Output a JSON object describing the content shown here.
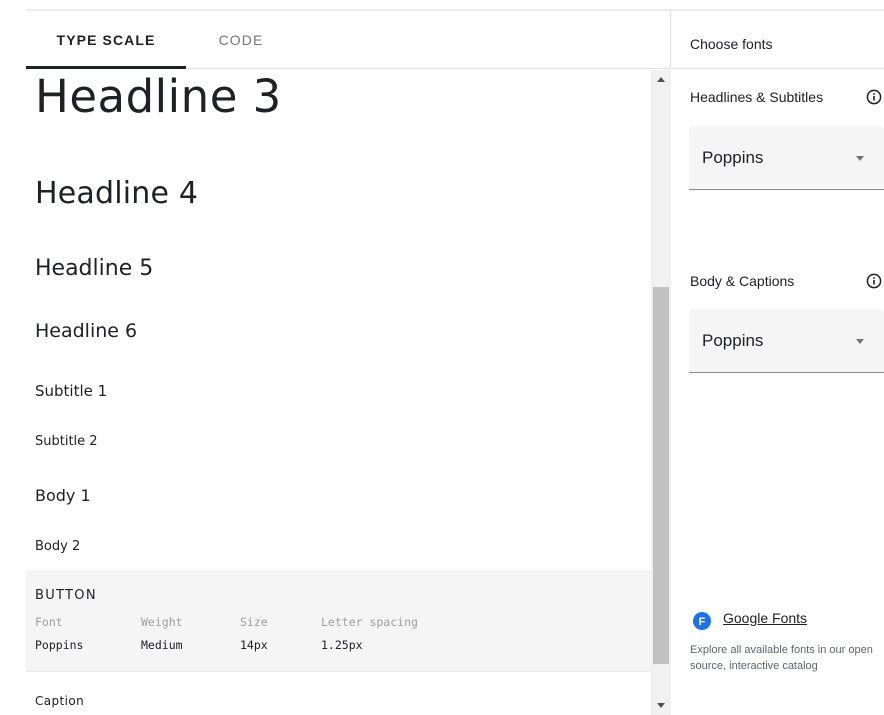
{
  "tabs": {
    "type_scale": "TYPE SCALE",
    "code": "CODE"
  },
  "type_scale": {
    "headline3": "Headline 3",
    "headline4": "Headline 4",
    "headline5": "Headline 5",
    "headline6": "Headline 6",
    "subtitle1": "Subtitle 1",
    "subtitle2": "Subtitle 2",
    "body1": "Body 1",
    "body2": "Body 2",
    "caption": "Caption",
    "button": {
      "title": "BUTTON",
      "headers": {
        "font": "Font",
        "weight": "Weight",
        "size": "Size",
        "letter_spacing": "Letter spacing"
      },
      "values": {
        "font": "Poppins",
        "weight": "Medium",
        "size": "14px",
        "letter_spacing": "1.25px"
      }
    }
  },
  "right_panel": {
    "title": "Choose fonts",
    "headlines_label": "Headlines & Subtitles",
    "headlines_font": "Poppins",
    "body_label": "Body & Captions",
    "body_font": "Poppins",
    "google_fonts": {
      "badge": "F",
      "link": "Google Fonts",
      "description": "Explore all available fonts in our open source, interactive catalog",
      "badge_color": "#1a73e8"
    }
  },
  "icons": {
    "info": "info-icon",
    "dropdown": "chevron-down-icon",
    "google_fonts": "google-fonts-icon"
  },
  "scroll_position": 0.45
}
